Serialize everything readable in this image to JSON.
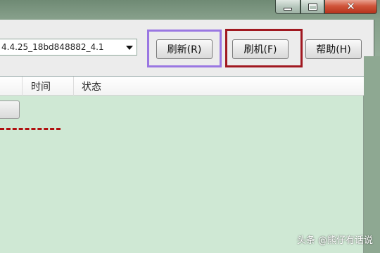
{
  "window": {
    "controls": {
      "minimize_icon": "minimize-icon",
      "maximize_icon": "maximize-icon",
      "close_icon": "close-icon",
      "close_glyph": "✕"
    }
  },
  "toolbar": {
    "firmware_value": "4.4.25_18bd848882_4.1",
    "refresh_label": "刷新(R)",
    "flash_label": "刷机(F)",
    "help_label": "帮助(H)"
  },
  "highlights": {
    "refresh_color": "#9a77e2",
    "flash_color": "#a01820"
  },
  "list": {
    "columns": [
      "时间",
      "状态"
    ],
    "background_color": "#cfe8d4"
  },
  "watermark": "头条 @熊仔有话说"
}
